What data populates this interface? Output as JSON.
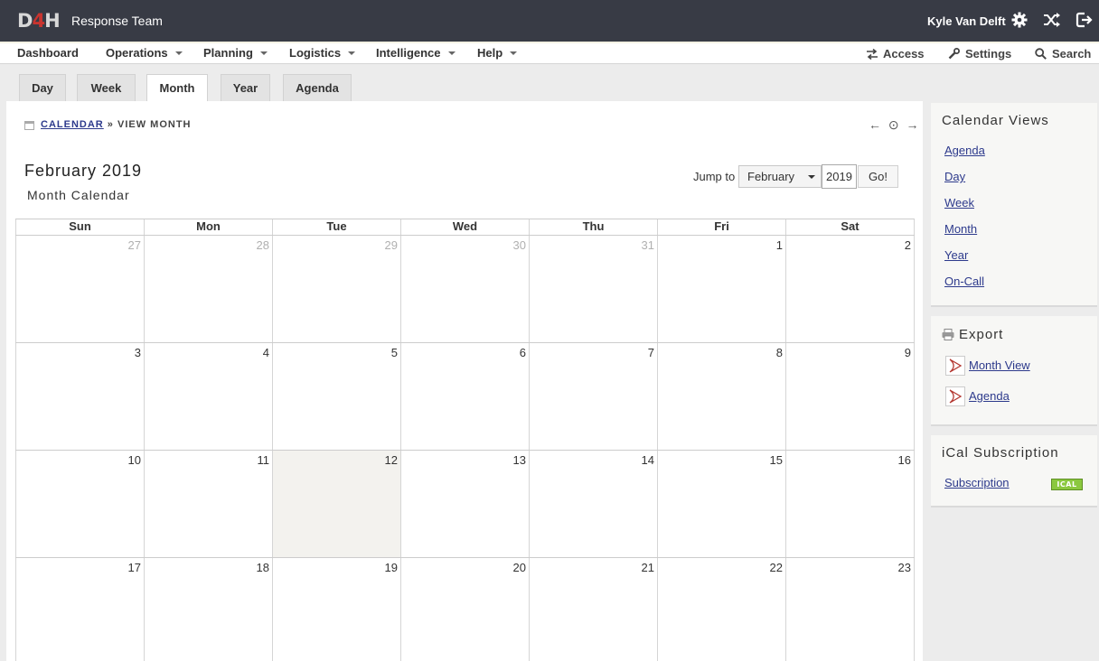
{
  "header": {
    "logo_d": "D",
    "logo_4": "4",
    "logo_h": "H",
    "team_name": "Response Team",
    "user_name": "Kyle Van Delft"
  },
  "nav": {
    "items": [
      {
        "label": "Dashboard"
      },
      {
        "label": "Operations"
      },
      {
        "label": "Planning"
      },
      {
        "label": "Logistics"
      },
      {
        "label": "Intelligence"
      },
      {
        "label": "Help"
      }
    ],
    "access_label": "Access",
    "settings_label": "Settings",
    "search_label": "Search"
  },
  "tabs": [
    {
      "label": "Day"
    },
    {
      "label": "Week"
    },
    {
      "label": "Month",
      "active": true
    },
    {
      "label": "Year"
    },
    {
      "label": "Agenda"
    }
  ],
  "breadcrumb": {
    "link": "CALENDAR",
    "separator": "»",
    "current": "VIEW MONTH"
  },
  "arrows": {
    "prev": "←",
    "today": "⊙",
    "next": "→"
  },
  "page": {
    "title": "February 2019",
    "subtitle": "Month Calendar"
  },
  "jump": {
    "label": "Jump to",
    "month": "February",
    "year": "2019",
    "go": "Go!"
  },
  "calendar": {
    "day_names": [
      "Sun",
      "Mon",
      "Tue",
      "Wed",
      "Thu",
      "Fri",
      "Sat"
    ],
    "weeks": [
      [
        "27",
        "28",
        "29",
        "30",
        "31",
        "1",
        "2"
      ],
      [
        "3",
        "4",
        "5",
        "6",
        "7",
        "8",
        "9"
      ],
      [
        "10",
        "11",
        "12",
        "13",
        "14",
        "15",
        "16"
      ],
      [
        "17",
        "18",
        "19",
        "20",
        "21",
        "22",
        "23"
      ]
    ],
    "today": "12"
  },
  "sidebar": {
    "views_title": "Calendar Views",
    "views": [
      "Agenda",
      "Day",
      "Week",
      "Month",
      "Year",
      "On-Call"
    ],
    "export_title": "Export",
    "exports": [
      "Month View",
      "Agenda"
    ],
    "ical_title": "iCal Subscription",
    "ical_link": "Subscription",
    "ical_badge": "ICAL"
  },
  "colors": {
    "topbar": "#383b45",
    "logo_accent": "#c9342f",
    "link": "#2d3a8c",
    "today_cell": "#f3f2ee",
    "ical_badge": "#8bc83f"
  }
}
